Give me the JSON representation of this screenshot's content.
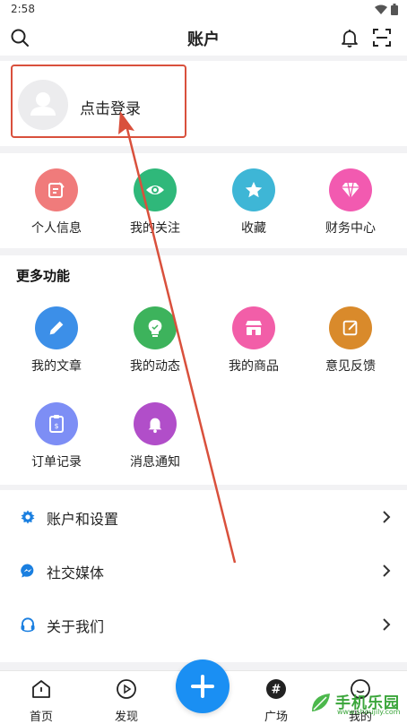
{
  "status_bar": {
    "time": "2:58",
    "wifi_icon": "wifi-icon",
    "battery_icon": "battery-icon"
  },
  "header": {
    "title": "账户",
    "search_icon": "search-icon",
    "bell_icon": "bell-icon",
    "scan_icon": "scan-icon"
  },
  "login": {
    "label": "点击登录"
  },
  "quick_items": [
    {
      "label": "个人信息",
      "icon": "edit-note-icon",
      "color": "#f07b7b"
    },
    {
      "label": "我的关注",
      "icon": "eye-icon",
      "color": "#2fb87a"
    },
    {
      "label": "收藏",
      "icon": "star-icon",
      "color": "#3eb6d6"
    },
    {
      "label": "财务中心",
      "icon": "diamond-icon",
      "color": "#f25ab0"
    }
  ],
  "more": {
    "title": "更多功能",
    "items": [
      {
        "label": "我的文章",
        "icon": "pen-icon",
        "color": "#3c8fe8"
      },
      {
        "label": "我的动态",
        "icon": "bulb-icon",
        "color": "#3db35c"
      },
      {
        "label": "我的商品",
        "icon": "store-icon",
        "color": "#f25ea8"
      },
      {
        "label": "意见反馈",
        "icon": "feedback-icon",
        "color": "#d98a2b"
      },
      {
        "label": "订单记录",
        "icon": "order-icon",
        "color": "#7d8ef5"
      },
      {
        "label": "消息通知",
        "icon": "bell-icon",
        "color": "#b14ec9"
      }
    ]
  },
  "menu": [
    {
      "label": "账户和设置",
      "icon": "gear-icon"
    },
    {
      "label": "社交媒体",
      "icon": "messenger-icon"
    },
    {
      "label": "关于我们",
      "icon": "headset-icon"
    }
  ],
  "tabs": [
    {
      "label": "首页",
      "icon": "home-icon"
    },
    {
      "label": "发现",
      "icon": "play-circle-icon"
    },
    {
      "label": "广场",
      "icon": "hash-icon"
    },
    {
      "label": "我的",
      "icon": "user-icon"
    }
  ],
  "watermark": {
    "text": "手机乐园",
    "url": "www.shoujily.com"
  },
  "colors": {
    "accent": "#1a8ff3",
    "highlight": "#d9503c",
    "icon_blue": "#1a7fe0"
  }
}
